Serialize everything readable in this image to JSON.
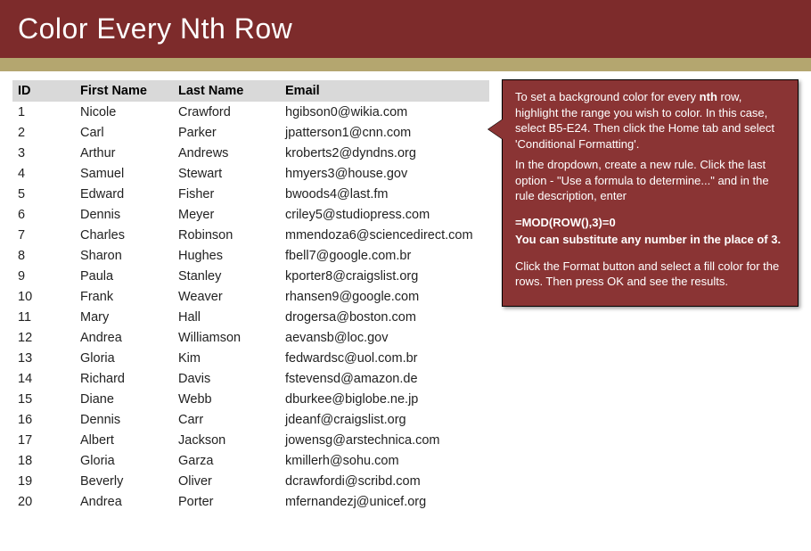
{
  "header": {
    "title": "Color Every Nth Row"
  },
  "table": {
    "columns": {
      "id": "ID",
      "first": "First Name",
      "last": "Last Name",
      "email": "Email"
    },
    "rows": [
      {
        "id": "1",
        "first": "Nicole",
        "last": "Crawford",
        "email": "hgibson0@wikia.com"
      },
      {
        "id": "2",
        "first": "Carl",
        "last": "Parker",
        "email": "jpatterson1@cnn.com"
      },
      {
        "id": "3",
        "first": "Arthur",
        "last": "Andrews",
        "email": "kroberts2@dyndns.org"
      },
      {
        "id": "4",
        "first": "Samuel",
        "last": "Stewart",
        "email": "hmyers3@house.gov"
      },
      {
        "id": "5",
        "first": "Edward",
        "last": "Fisher",
        "email": "bwoods4@last.fm"
      },
      {
        "id": "6",
        "first": "Dennis",
        "last": "Meyer",
        "email": "criley5@studiopress.com"
      },
      {
        "id": "7",
        "first": "Charles",
        "last": "Robinson",
        "email": "mmendoza6@sciencedirect.com"
      },
      {
        "id": "8",
        "first": "Sharon",
        "last": "Hughes",
        "email": "fbell7@google.com.br"
      },
      {
        "id": "9",
        "first": "Paula",
        "last": "Stanley",
        "email": "kporter8@craigslist.org"
      },
      {
        "id": "10",
        "first": "Frank",
        "last": "Weaver",
        "email": "rhansen9@google.com"
      },
      {
        "id": "11",
        "first": "Mary",
        "last": "Hall",
        "email": "drogersa@boston.com"
      },
      {
        "id": "12",
        "first": "Andrea",
        "last": "Williamson",
        "email": "aevansb@loc.gov"
      },
      {
        "id": "13",
        "first": "Gloria",
        "last": "Kim",
        "email": "fedwardsc@uol.com.br"
      },
      {
        "id": "14",
        "first": "Richard",
        "last": "Davis",
        "email": "fstevensd@amazon.de"
      },
      {
        "id": "15",
        "first": "Diane",
        "last": "Webb",
        "email": "dburkee@biglobe.ne.jp"
      },
      {
        "id": "16",
        "first": "Dennis",
        "last": "Carr",
        "email": "jdeanf@craigslist.org"
      },
      {
        "id": "17",
        "first": "Albert",
        "last": "Jackson",
        "email": "jowensg@arstechnica.com"
      },
      {
        "id": "18",
        "first": "Gloria",
        "last": "Garza",
        "email": "kmillerh@sohu.com"
      },
      {
        "id": "19",
        "first": "Beverly",
        "last": "Oliver",
        "email": "dcrawfordi@scribd.com"
      },
      {
        "id": "20",
        "first": "Andrea",
        "last": "Porter",
        "email": "mfernandezj@unicef.org"
      }
    ]
  },
  "callout": {
    "p1a": "To set a background color for every ",
    "p1b": "nth",
    "p1c": " row, highlight the range you wish to color. In this case, select B5-E24. Then click the Home tab and select 'Conditional Formatting'.",
    "p2": "In the dropdown, create a new rule. Click the last option - \"Use a formula to determine...\" and in the rule description, enter",
    "formula": "=MOD(ROW(),3)=0",
    "sub": "You can substitute any number in the place of 3.",
    "p3": "Click the Format button and select a fill color for the rows. Then press OK and see the results."
  }
}
